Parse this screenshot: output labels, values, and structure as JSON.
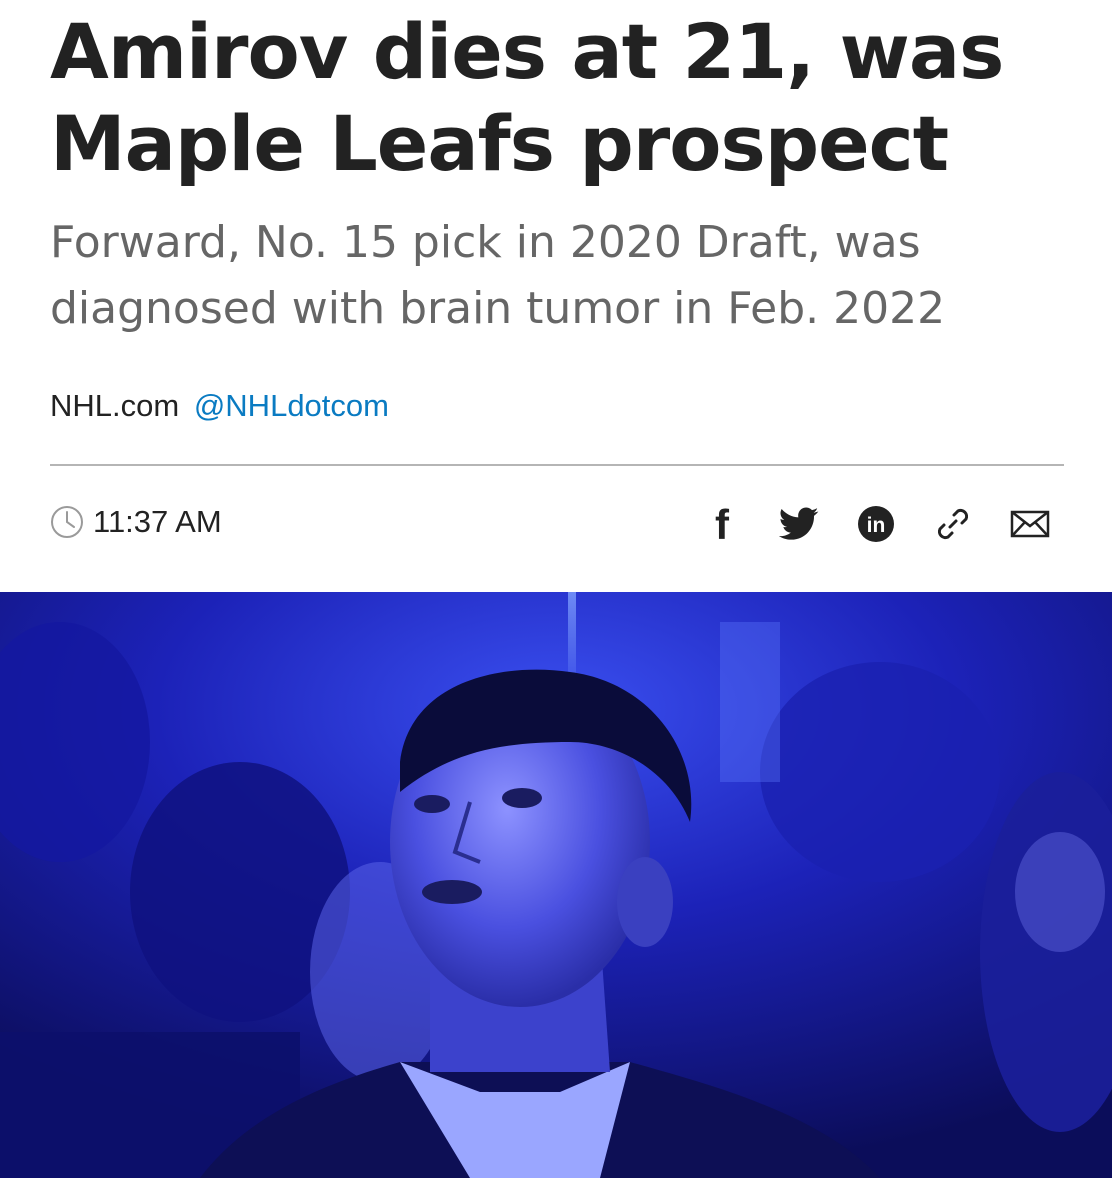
{
  "article": {
    "headline": "Amirov dies at 21, was Maple Leafs prospect",
    "subhead": "Forward, No. 15 pick in 2020 Draft, was diagnosed with brain tumor in Feb. 2022",
    "byline": {
      "author": "NHL.com",
      "handle": "@NHLdotcom"
    },
    "time": "11:37 AM"
  },
  "share": {
    "buttons": [
      {
        "icon": "facebook-icon",
        "label": "f"
      },
      {
        "icon": "twitter-icon"
      },
      {
        "icon": "linkedin-icon",
        "label": "in"
      },
      {
        "icon": "link-icon"
      },
      {
        "icon": "email-icon"
      }
    ]
  },
  "colors": {
    "headline": "#222222",
    "subhead": "#666666",
    "link": "#0a7bc2",
    "divider": "#b5b5b5",
    "photo_tint": "#1a1fd0"
  }
}
